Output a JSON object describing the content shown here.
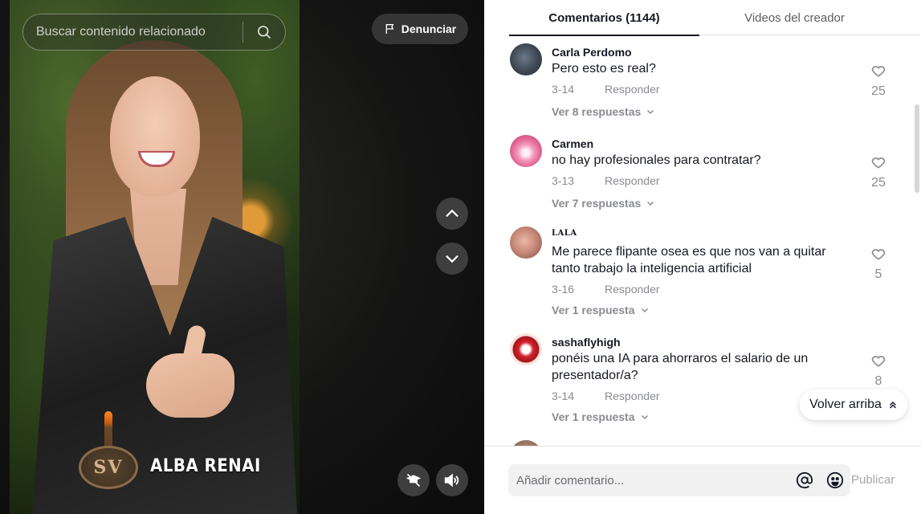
{
  "video": {
    "search_placeholder": "Buscar contenido relacionado",
    "report_label": "Denunciar",
    "host_name": "ALBA RENAI",
    "logo_text": "SV",
    "icons": {
      "search": "search-icon",
      "report": "flag-icon",
      "prev": "chevron-up-icon",
      "next": "chevron-down-icon",
      "hat": "graduation-cap-icon",
      "volume": "volume-icon"
    }
  },
  "tabs": [
    {
      "label": "Comentarios (1144)",
      "active": true
    },
    {
      "label": "Videos del creador",
      "active": false
    }
  ],
  "comments": [
    {
      "user": "Carla Perdomo",
      "text": "Pero esto es real?",
      "date": "3-14",
      "reply": "Responder",
      "replies": "Ver 8 respuestas",
      "likes": "25"
    },
    {
      "user": "Carmen",
      "text": "no hay profesionales para contratar?",
      "date": "3-13",
      "reply": "Responder",
      "replies": "Ver 7 respuestas",
      "likes": "25"
    },
    {
      "user": "LALA",
      "text": "Me parece flipante osea es que nos van a quitar tanto trabajo la inteligencia artificial",
      "date": "3-16",
      "reply": "Responder",
      "replies": "Ver 1 respuesta",
      "likes": "5"
    },
    {
      "user": "sashaflyhigh",
      "text": "ponéis una IA para ahorraros el salario de un presentador/a?",
      "date": "3-14",
      "reply": "Responder",
      "replies": "Ver 1 respuesta",
      "likes": "8"
    }
  ],
  "back_to_top": "Volver arriba",
  "composer": {
    "placeholder": "Añadir comentario...",
    "publish_label": "Publicar"
  },
  "colors": {
    "text_primary": "#161823",
    "text_secondary": "#8a8b91",
    "divider": "#e3e3e4"
  }
}
